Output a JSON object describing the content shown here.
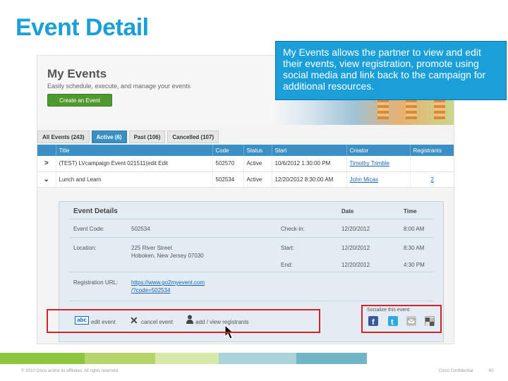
{
  "slide": {
    "title": "Event Detail",
    "callout": "My Events allows the partner to view and edit their events, view registration, promote using social media and link back to the campaign for additional resources.",
    "footer_left": "© 2010 Cisco and/or its affiliates. All rights reserved.",
    "footer_right": "Cisco Confidential",
    "page_number": "62"
  },
  "hero": {
    "title": "My Events",
    "subtitle": "Easily schedule, execute, and manage your events",
    "create_button": "Create an Event"
  },
  "tabs": [
    {
      "label": "All Events (243)",
      "active": false
    },
    {
      "label": "Active (6)",
      "active": true
    },
    {
      "label": "Past (106)",
      "active": false
    },
    {
      "label": "Cancelled (107)",
      "active": false
    }
  ],
  "table": {
    "columns": [
      "Title",
      "Code",
      "Status",
      "Start",
      "Creator",
      "Registrants"
    ],
    "rows": [
      {
        "expander": ">",
        "title": "(TEST) LVcampaign Event 021511(edit  Edit",
        "code": "502570",
        "status": "Active",
        "start": "10/6/2012 1:30:00 PM",
        "creator": "Timothy Trimble",
        "registrants": ""
      },
      {
        "expander": "⌄",
        "title": "Lunch and Learn",
        "code": "502534",
        "status": "Active",
        "start": "12/20/2012 8:30:00 AM",
        "creator": "John Micas",
        "registrants": "2"
      }
    ]
  },
  "details": {
    "heading": "Event Details",
    "date_header": "Date",
    "time_header": "Time",
    "code_label": "Event Code:",
    "code_value": "502534",
    "location_label": "Location:",
    "location_line1": "225 River Street",
    "location_line2": "Hoboken, New Jersey 07030",
    "registration_label": "Registration URL:",
    "registration_line1": "https://www.go2myevent.com",
    "registration_line2": "/?code=502534",
    "schedule": [
      {
        "label": "Check-in:",
        "date": "12/20/2012",
        "time": "8:00 AM"
      },
      {
        "label": "Start:",
        "date": "12/20/2012",
        "time": "8:30 AM"
      },
      {
        "label": "End:",
        "date": "12/20/2012",
        "time": "4:30 PM"
      }
    ],
    "actions": {
      "edit_icon_text": "abc",
      "edit": "edit event",
      "cancel_icon": "✕",
      "cancel": "cancel event",
      "registrants": "add / view registrants"
    },
    "social": {
      "label": "Socialize this event:",
      "icons": [
        "facebook-icon",
        "twitter-icon",
        "email-icon",
        "delicious-icon"
      ]
    }
  },
  "colors": {
    "title_blue": "#1a9fd8",
    "header_blue": "#3a8fc4",
    "highlight_red": "#d6202a",
    "button_green": "#4f9a2f"
  }
}
